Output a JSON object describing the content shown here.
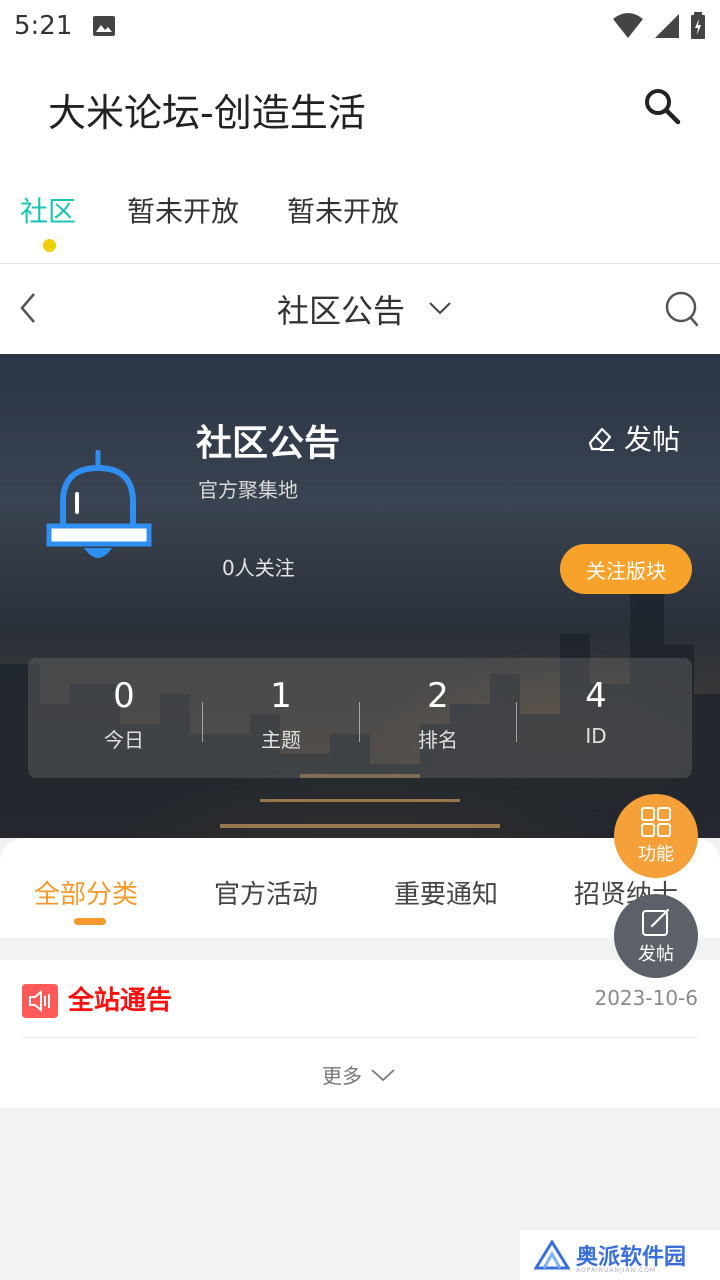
{
  "status_bar": {
    "time": "5:21"
  },
  "app_bar": {
    "title": "大米论坛-创造生活"
  },
  "top_tabs": [
    {
      "label": "社区"
    },
    {
      "label": "暂未开放"
    },
    {
      "label": "暂未开放"
    }
  ],
  "sub_bar": {
    "title": "社区公告"
  },
  "forum": {
    "name": "社区公告",
    "description": "官方聚集地",
    "post_label": "发帖",
    "followers": "0人关注",
    "follow_button": "关注版块",
    "stats": [
      {
        "value": "0",
        "label": "今日"
      },
      {
        "value": "1",
        "label": "主题"
      },
      {
        "value": "2",
        "label": "排名"
      },
      {
        "value": "4",
        "label": "ID"
      }
    ]
  },
  "category_tabs": [
    {
      "label": "全部分类"
    },
    {
      "label": "官方活动"
    },
    {
      "label": "重要通知"
    },
    {
      "label": "招贤纳士"
    }
  ],
  "notice": {
    "title": "全站通告",
    "date": "2023-10-6"
  },
  "more_label": "更多",
  "fabs": {
    "func_label": "功能",
    "post_label": "发帖"
  },
  "watermark": {
    "text": "奥派软件园",
    "sub": "AOPAIRUANJIAN.COM"
  },
  "colors": {
    "accent_teal": "#1cc4b8",
    "accent_orange": "#f49a2c",
    "notice_red": "#ff1010"
  }
}
